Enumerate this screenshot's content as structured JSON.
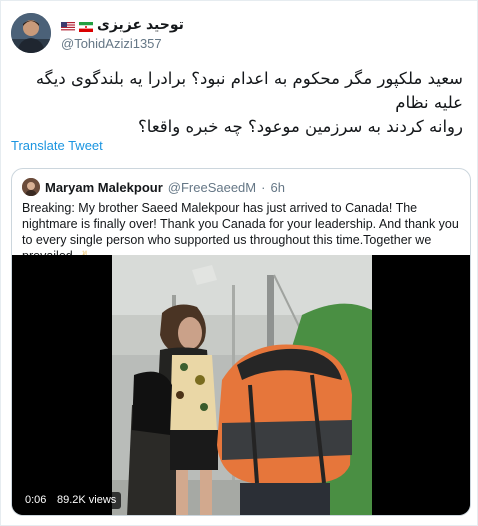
{
  "tweet": {
    "display_name": "توحید عزیزی",
    "handle": "@TohidAzizi1357",
    "text_line1": "سعید ملکپور مگر محکوم به اعدام نبود؟ برادرا یه بلندگوی دیگه علیه نظام",
    "text_line2": "روانه کردند به سرزمین موعود؟ چه خبره واقعا؟",
    "translate_label": "Translate Tweet",
    "flags": [
      "iran-flag-icon",
      "usa-flag-icon"
    ]
  },
  "quoted": {
    "display_name": "Maryam Malekpour",
    "handle": "@FreeSaeedM",
    "separator": "·",
    "time": "6h",
    "text": "Breaking: My brother Saeed Malekpour has just arrived to Canada! The nightmare is finally over! Thank you Canada for your leadership. And thank you to every single person who supported us throughout this time.Together we prevailed.",
    "emoji": "✌",
    "video": {
      "timestamp": "0:06",
      "views": "89.2K views"
    }
  },
  "colors": {
    "link": "#1b95e0",
    "secondary_text": "#657786",
    "border": "#ccd6dd"
  }
}
